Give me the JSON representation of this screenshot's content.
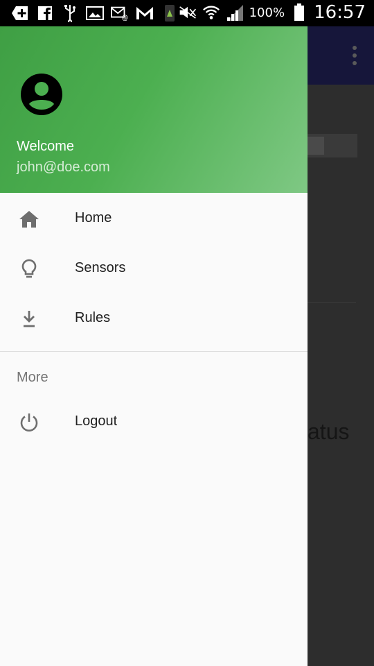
{
  "status_bar": {
    "battery_percent": "100%",
    "time": "16:57",
    "icons_left": [
      "add-box-icon",
      "facebook-icon",
      "usb-icon",
      "image-icon",
      "email-at-icon",
      "gmail-icon",
      "game-icon"
    ],
    "icons_right": [
      "mute-icon",
      "wifi-icon",
      "signal-icon",
      "battery-icon"
    ]
  },
  "drawer": {
    "header": {
      "welcome": "Welcome",
      "email": "john@doe.com",
      "avatar_icon": "account-circle-icon"
    },
    "items": [
      {
        "label": "Home",
        "icon": "home-icon"
      },
      {
        "label": "Sensors",
        "icon": "lightbulb-icon"
      },
      {
        "label": "Rules",
        "icon": "download-icon"
      }
    ],
    "section": {
      "title": "More",
      "items": [
        {
          "label": "Logout",
          "icon": "power-icon"
        }
      ]
    }
  },
  "background": {
    "partial_text": "atus"
  },
  "colors": {
    "header_green": "#4caf50",
    "toolbar_navy": "#16163a",
    "drawer_bg": "#fafafa"
  }
}
